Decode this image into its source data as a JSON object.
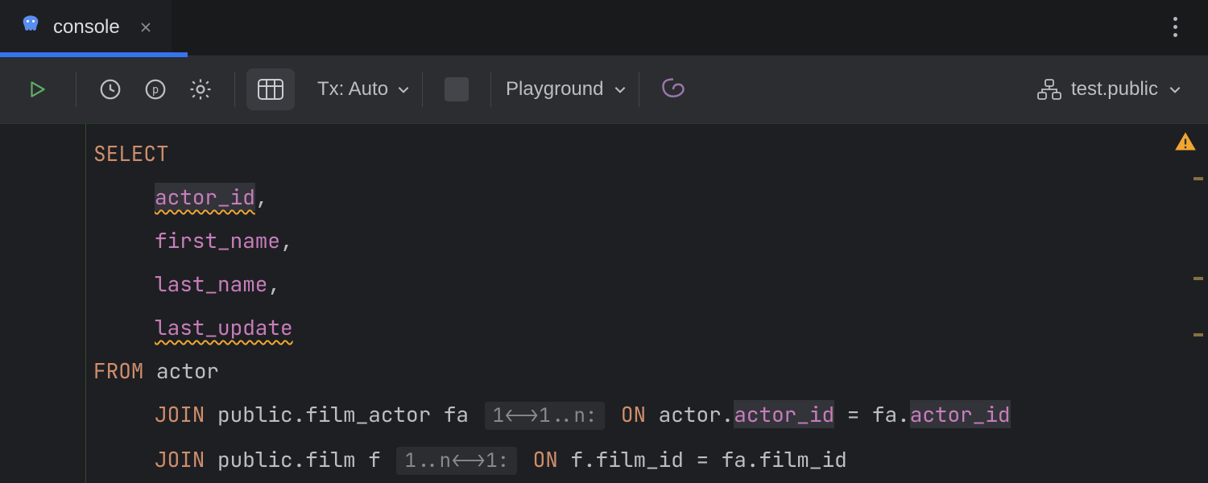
{
  "tab": {
    "title": "console"
  },
  "toolbar": {
    "tx_label": "Tx: Auto",
    "mode_label": "Playground",
    "schema_label": "test.public"
  },
  "sql": {
    "kw_select": "SELECT",
    "col1": "actor_id",
    "col2": "first_name",
    "col3": "last_name",
    "col4": "last_update",
    "kw_from": "FROM",
    "table1": "actor",
    "kw_join1": "JOIN",
    "qual1": "public.film_actor fa",
    "hint1": "1<->1..n:",
    "kw_on1": "ON",
    "join1_lhs_q": "actor.",
    "join1_lhs_c": "actor_id",
    "join1_rhs_q": "fa.",
    "join1_rhs_c": "actor_id",
    "kw_join2": "JOIN",
    "qual2": "public.film f",
    "hint2": "1..n<->1:",
    "kw_on2": "ON",
    "join2_lhs": "f.film_id",
    "join2_rhs": "fa.film_id",
    "eq": " = "
  }
}
